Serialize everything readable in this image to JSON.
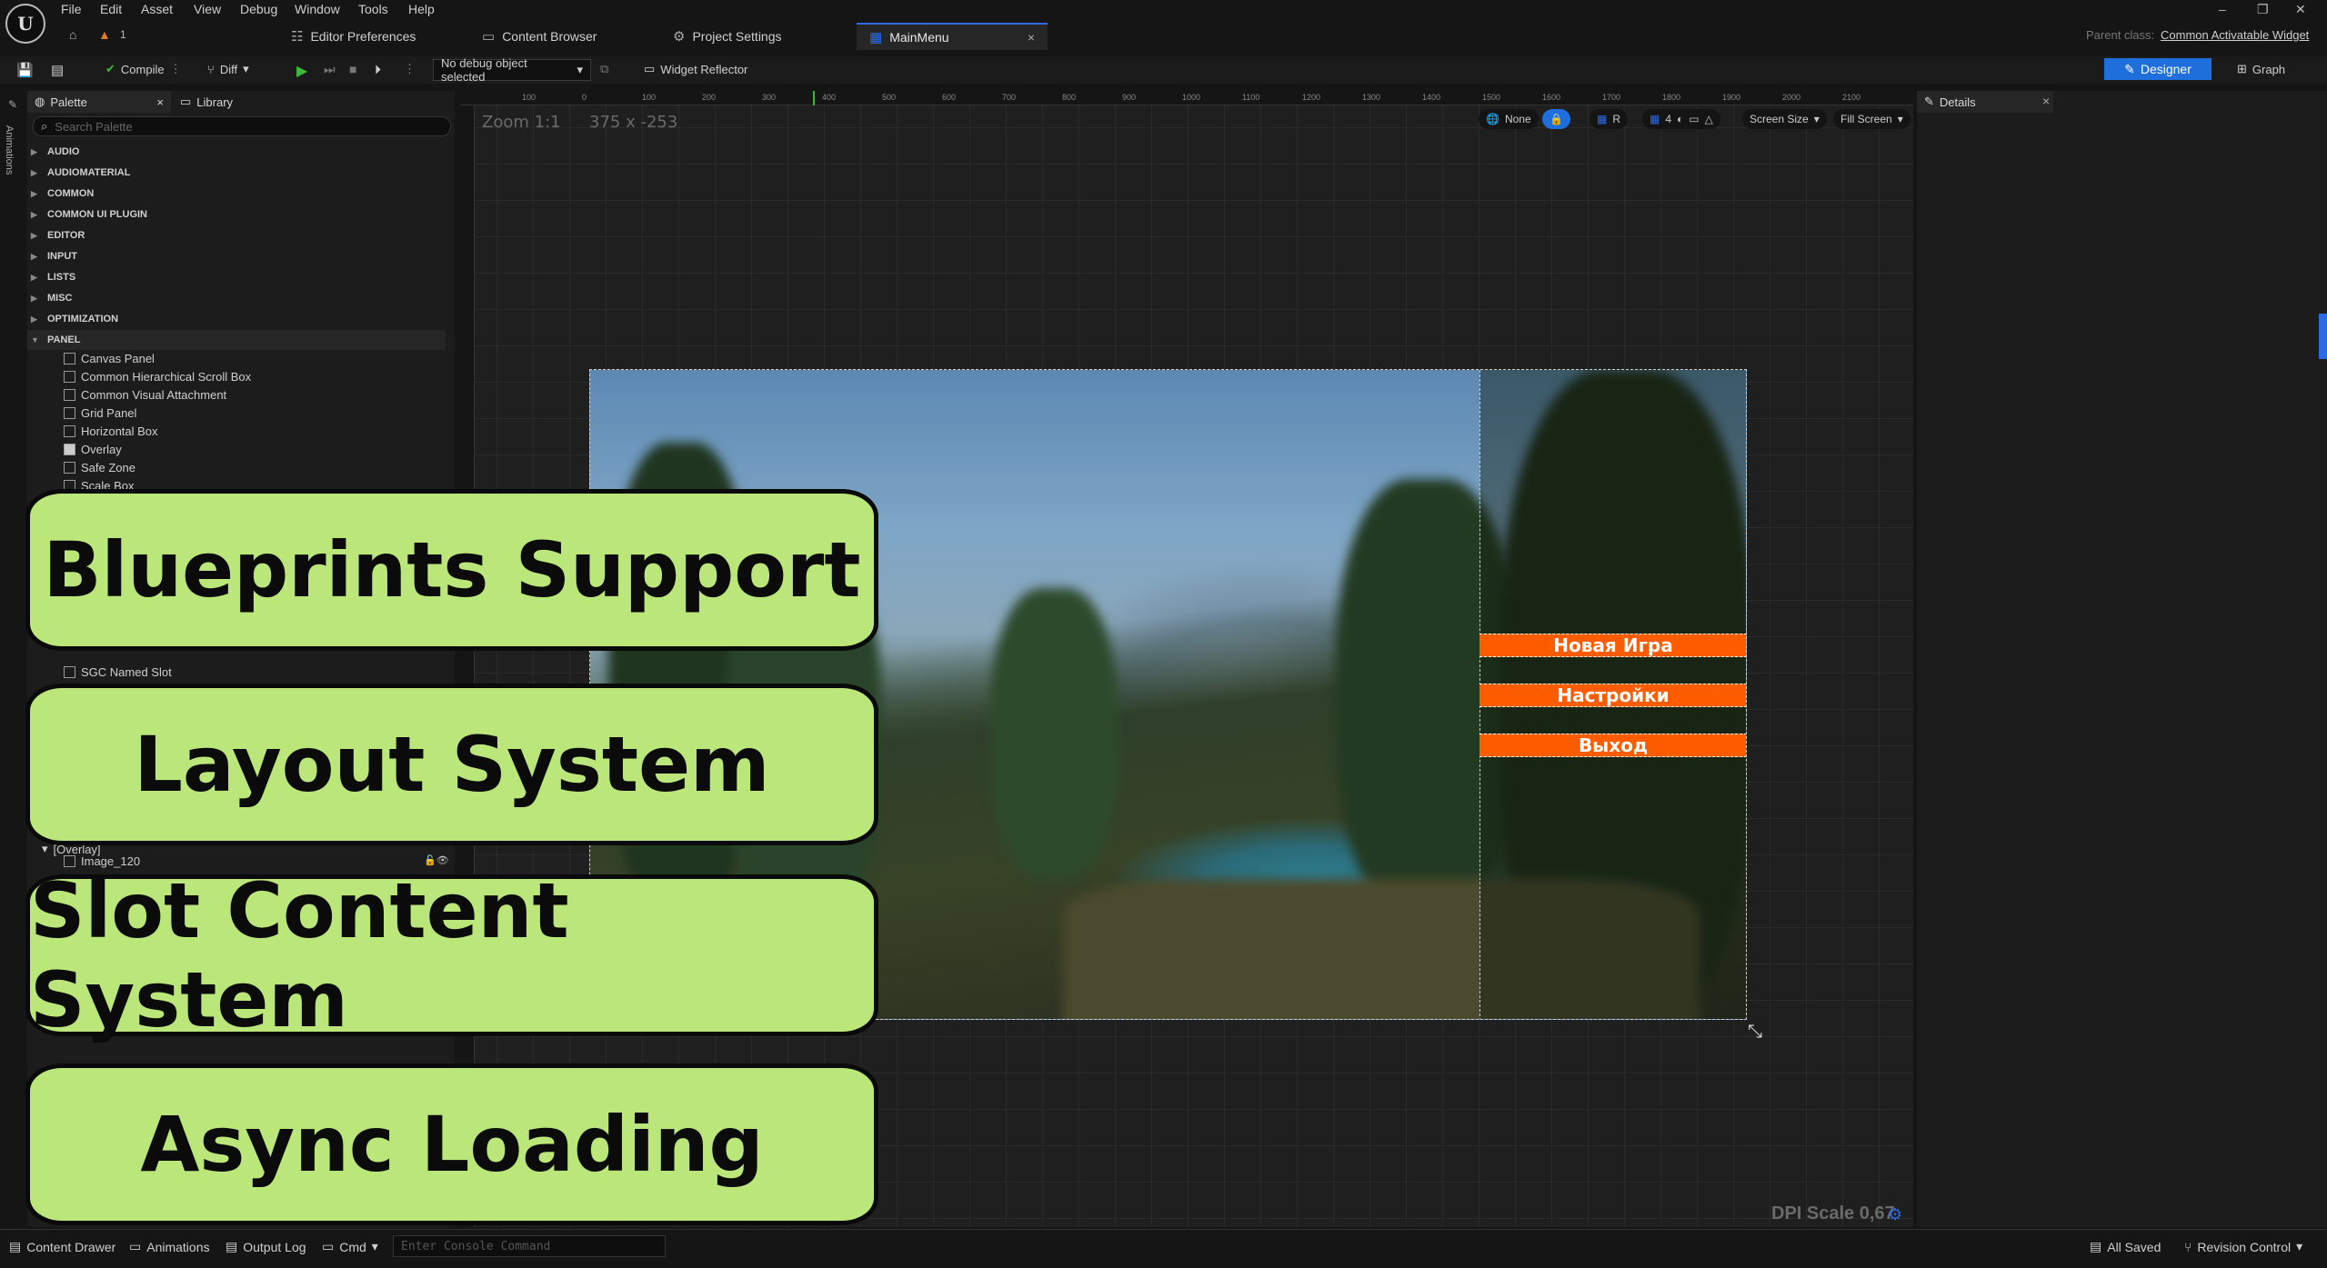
{
  "menu": [
    "File",
    "Edit",
    "Asset",
    "View",
    "Debug",
    "Window",
    "Tools",
    "Help"
  ],
  "tabs": [
    {
      "label": "Editor Preferences"
    },
    {
      "label": "Content Browser"
    },
    {
      "label": "Project Settings"
    },
    {
      "label": "MainMenu"
    }
  ],
  "home_count": "1",
  "parent_class_label": "Parent class:",
  "parent_class_value": "Common Activatable Widget",
  "toolbar": {
    "compile": "Compile",
    "diff": "Diff",
    "debug_select": "No debug object selected",
    "widget_reflector": "Widget Reflector",
    "designer": "Designer",
    "graph": "Graph"
  },
  "left_strip_label": "Animations",
  "palette": {
    "tab_palette": "Palette",
    "tab_library": "Library",
    "search_placeholder": "Search Palette",
    "categories": [
      "AUDIO",
      "AUDIOMATERIAL",
      "COMMON",
      "COMMON UI PLUGIN",
      "EDITOR",
      "INPUT",
      "LISTS",
      "MISC",
      "OPTIMIZATION",
      "PANEL"
    ],
    "panel_items": [
      "Canvas Panel",
      "Common Hierarchical Scroll Box",
      "Common Visual Attachment",
      "Grid Panel",
      "Horizontal Box",
      "Overlay",
      "Safe Zone",
      "Scale Box"
    ],
    "sgc_item": "SGC Named Slot",
    "hier_overlay": "[Overlay]",
    "hier_image": "Image_120"
  },
  "canvas": {
    "zoom": "Zoom 1:1",
    "coords": "375 x -253",
    "ctrl_none": "None",
    "ctrl_r": "R",
    "ctrl_4": "4",
    "screen_size": "Screen Size",
    "fill_screen": "Fill Screen",
    "dpi": "DPI Scale 0,67",
    "ruler_labels": [
      "100",
      "0",
      "100",
      "200",
      "300",
      "400",
      "500",
      "600",
      "700",
      "800",
      "900",
      "1000",
      "1100",
      "1200",
      "1300",
      "1400",
      "1500",
      "1600",
      "1700",
      "1800",
      "1900",
      "2000",
      "2100"
    ]
  },
  "game_menu": [
    "Новая Игра",
    "Настройки",
    "Выход"
  ],
  "callouts": [
    "Blueprints Support",
    "Layout System",
    "Slot Content System",
    "Async Loading"
  ],
  "details": {
    "title": "Details"
  },
  "statusbar": {
    "content_drawer": "Content Drawer",
    "animations": "Animations",
    "output_log": "Output Log",
    "cmd": "Cmd",
    "console_placeholder": "Enter Console Command",
    "all_saved": "All Saved",
    "revision_control": "Revision Control"
  },
  "colors": {
    "accent": "#2d6be5",
    "menu_button": "#fe5c01",
    "callout": "#bae67a"
  }
}
